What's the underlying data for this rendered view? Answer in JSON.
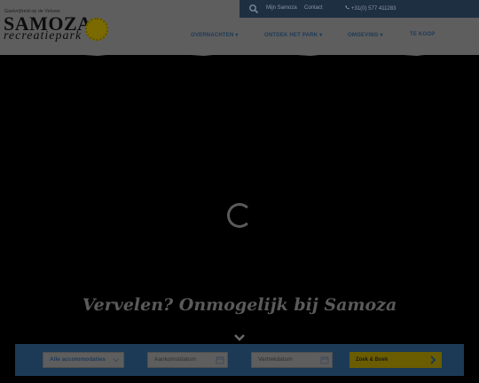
{
  "header": {
    "logo": {
      "tagline": "Gastvrijheid op de Veluwe",
      "title": "SAMOZA",
      "subtitle": "recreatiepark"
    },
    "utility": {
      "search_icon": "search-icon",
      "mijn_label": "Mijn Samoza",
      "contact_label": "Contact",
      "phone_icon": "phone-icon",
      "phone": "+31(0) 577 411283"
    },
    "nav": [
      {
        "label": "OVERNACHTEN ▾"
      },
      {
        "label": "ONTDEK HET PARK ▾"
      },
      {
        "label": "OMGEVING ▾"
      },
      {
        "label": "TE KOOP"
      }
    ]
  },
  "hero": {
    "title": "Vervelen? Onmogelijk bij Samoza",
    "loading_icon": "spinner-icon",
    "scroll_icon": "chevron-down-icon"
  },
  "booking": {
    "accommodation_value": "Alle accommodaties",
    "arrival_placeholder": "Aankomstdatum",
    "departure_placeholder": "Vertrekdatum",
    "search_button": "Zoek & Boek"
  },
  "colors": {
    "overlay_bg": "#000000",
    "utility_bar": "#1f2f42",
    "booking_bar": "#1c3a55",
    "accent": "#6a5c00"
  }
}
